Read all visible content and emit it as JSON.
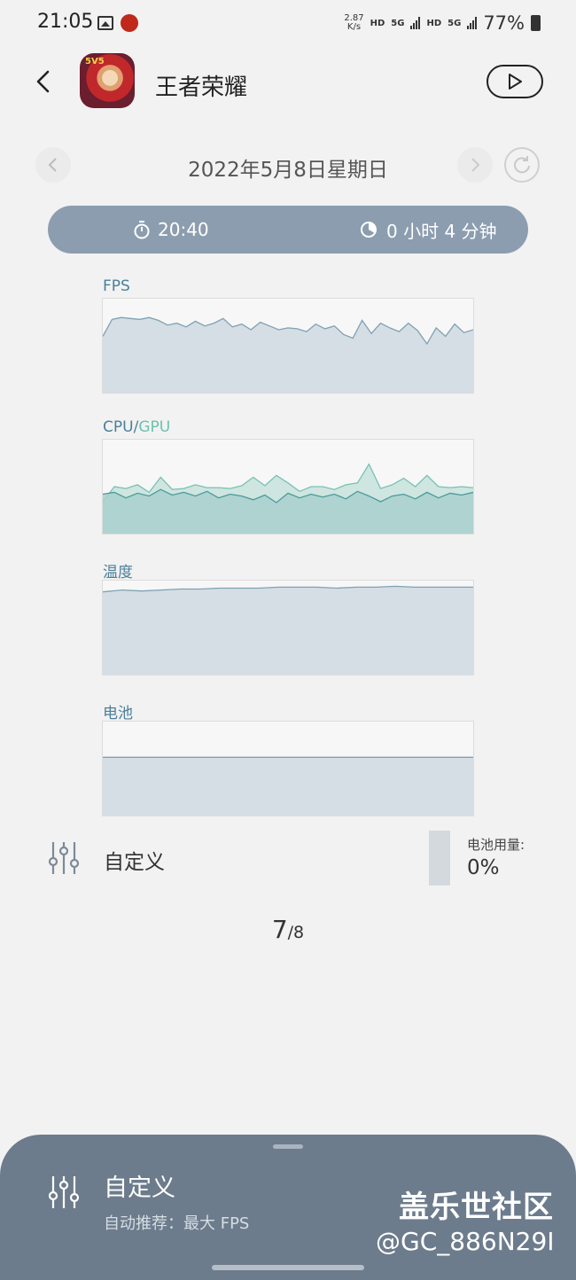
{
  "status_bar": {
    "time": "21:05",
    "net_speed_value": "2.87",
    "net_speed_unit": "K/s",
    "hd1": "HD",
    "net1": "5G",
    "hd2": "HD",
    "net2": "5G",
    "battery": "77%",
    "icons": [
      "image-icon",
      "app-notification-icon",
      "signal-icon",
      "battery-icon"
    ]
  },
  "header": {
    "title": "王者荣耀",
    "app_badge": "5V5"
  },
  "date_nav": {
    "date": "2022年5月8日星期日"
  },
  "session": {
    "start_time": "20:40",
    "duration": "0 小时 4 分钟"
  },
  "charts": {
    "fps_label": "FPS",
    "cpu_label": "CPU",
    "slash": "/",
    "gpu_label": "GPU",
    "temp_label": "温度",
    "battery_label": "电池"
  },
  "chart_data": [
    {
      "type": "area",
      "title": "FPS",
      "ylim": [
        0,
        1
      ],
      "values": [
        0.6,
        0.78,
        0.8,
        0.79,
        0.78,
        0.8,
        0.77,
        0.72,
        0.74,
        0.7,
        0.76,
        0.71,
        0.74,
        0.79,
        0.7,
        0.73,
        0.67,
        0.75,
        0.71,
        0.67,
        0.69,
        0.68,
        0.65,
        0.73,
        0.68,
        0.71,
        0.62,
        0.58,
        0.77,
        0.63,
        0.74,
        0.69,
        0.65,
        0.74,
        0.66,
        0.52,
        0.69,
        0.6,
        0.73,
        0.64,
        0.67
      ]
    },
    {
      "type": "area",
      "series": [
        {
          "name": "CPU",
          "values": [
            0.34,
            0.5,
            0.48,
            0.52,
            0.44,
            0.6,
            0.47,
            0.48,
            0.52,
            0.49,
            0.49,
            0.48,
            0.51,
            0.6,
            0.51,
            0.62,
            0.54,
            0.45,
            0.5,
            0.5,
            0.47,
            0.52,
            0.54,
            0.74,
            0.48,
            0.52,
            0.59,
            0.5,
            0.62,
            0.5,
            0.49,
            0.5,
            0.49
          ]
        },
        {
          "name": "GPU",
          "values": [
            0.42,
            0.44,
            0.38,
            0.43,
            0.4,
            0.47,
            0.41,
            0.44,
            0.4,
            0.45,
            0.38,
            0.42,
            0.4,
            0.36,
            0.41,
            0.33,
            0.43,
            0.38,
            0.42,
            0.39,
            0.42,
            0.37,
            0.45,
            0.4,
            0.34,
            0.4,
            0.42,
            0.37,
            0.44,
            0.38,
            0.43,
            0.41,
            0.44
          ]
        }
      ],
      "ylim": [
        0,
        1
      ]
    },
    {
      "type": "area",
      "title": "温度",
      "ylim": [
        0,
        1
      ],
      "values": [
        0.88,
        0.9,
        0.89,
        0.9,
        0.91,
        0.91,
        0.92,
        0.92,
        0.92,
        0.93,
        0.93,
        0.93,
        0.92,
        0.93,
        0.93,
        0.94,
        0.93,
        0.93,
        0.93,
        0.93
      ]
    },
    {
      "type": "area",
      "title": "电池",
      "ylim": [
        0,
        1
      ],
      "values": [
        0.62,
        0.62
      ]
    }
  ],
  "customize": {
    "label": "自定义",
    "battery_usage_label": "电池用量:",
    "battery_usage_value": "0%"
  },
  "pager": {
    "current": "7",
    "total": "/8"
  },
  "bottom_sheet": {
    "title": "自定义",
    "subtitle": "自动推荐：最大 FPS"
  },
  "watermark": {
    "line1": "盖乐世社区",
    "line2": "@GC_886N29I"
  },
  "colors": {
    "pill": "#8c9db0",
    "sheet": "#6d7c8c",
    "fps_fill": "#cfd9e0",
    "fps_line": "#7fa1b4",
    "cpu_fill": "#c7e2dc",
    "cpu_line": "#79c2b2",
    "gpu_fill": "#a9d0cd",
    "gpu_line": "#4a9a9a"
  }
}
